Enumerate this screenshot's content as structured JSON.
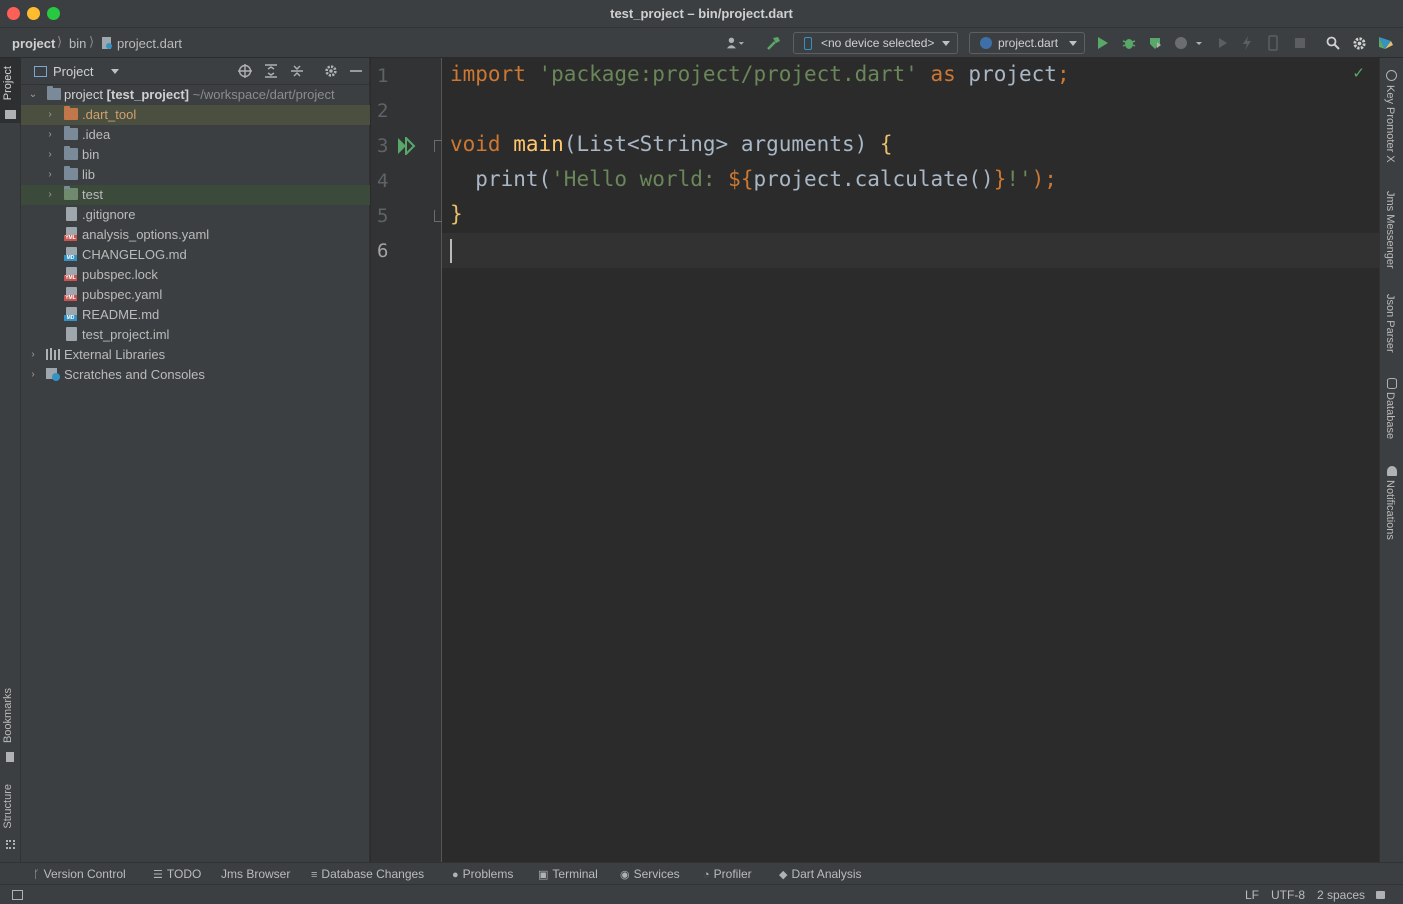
{
  "window": {
    "title": "test_project – bin/project.dart"
  },
  "breadcrumb": {
    "items": [
      "project",
      "bin",
      "project.dart"
    ]
  },
  "toolbar": {
    "device_selector": "<no device selected>",
    "run_config": "project.dart"
  },
  "left_tabs": {
    "project": "Project",
    "bookmarks": "Bookmarks",
    "structure": "Structure"
  },
  "project_panel": {
    "title": "Project",
    "root": {
      "name": "project",
      "module": "[test_project]",
      "path": "~/workspace/dart/project"
    },
    "items": [
      ".dart_tool",
      ".idea",
      "bin",
      "lib",
      "test",
      ".gitignore",
      "analysis_options.yaml",
      "CHANGELOG.md",
      "pubspec.lock",
      "pubspec.yaml",
      "README.md",
      "test_project.iml"
    ],
    "external_libraries": "External Libraries",
    "scratches": "Scratches and Consoles"
  },
  "editor": {
    "line_numbers": [
      "1",
      "2",
      "3",
      "4",
      "5",
      "6"
    ],
    "code": {
      "l1_import": "import",
      "l1_str": "'package:project/project.dart'",
      "l1_as": "as",
      "l1_name": "project",
      "l1_semi": ";",
      "l3_void": "void",
      "l3_main": "main",
      "l3_params": "(List<String> arguments) ",
      "l3_brace": "{",
      "l4_print": "print(",
      "l4_str1": "'Hello world: ",
      "l4_interp_open": "${",
      "l4_expr": "project.calculate()",
      "l4_interp_close": "}",
      "l4_str2": "!'",
      "l4_end": ");",
      "l5_brace": "}"
    }
  },
  "right_tabs": [
    "Key Promoter X",
    "Jms Messenger",
    "Json Parser",
    "Database",
    "Notifications"
  ],
  "bottom_tabs": [
    "Version Control",
    "TODO",
    "Jms Browser",
    "Database Changes",
    "Problems",
    "Terminal",
    "Services",
    "Profiler",
    "Dart Analysis"
  ],
  "status_bar": {
    "line_sep": "LF",
    "encoding": "UTF-8",
    "indent": "2 spaces"
  },
  "colors": {
    "keyword": "#cc7832",
    "string": "#6a8759",
    "function": "#ffc66d",
    "run_green": "#59a869"
  }
}
